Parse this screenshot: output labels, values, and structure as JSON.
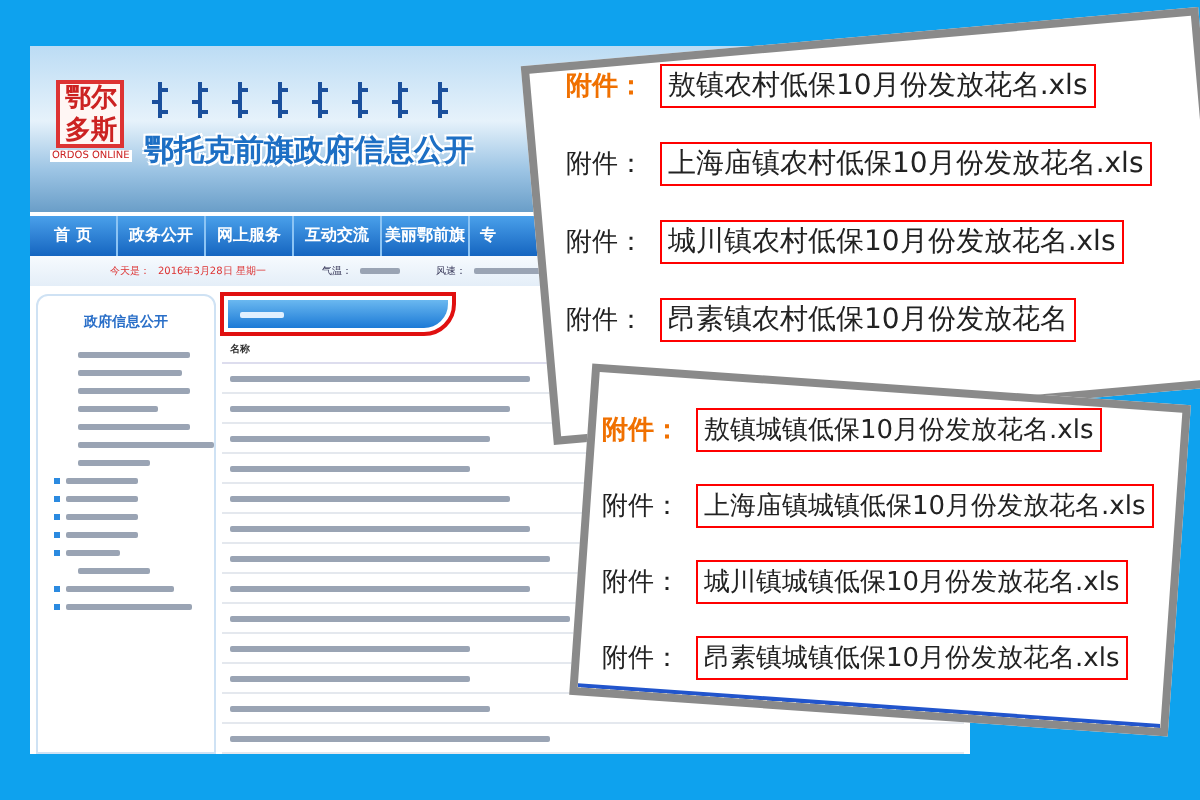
{
  "site": {
    "logo": {
      "seal": "鄂尔多斯",
      "caption": "ORDOS ONLINE"
    },
    "title": "鄂托克前旗政府信息公开"
  },
  "nav": [
    {
      "label": "首 页"
    },
    {
      "label": "政务公开"
    },
    {
      "label": "网上服务"
    },
    {
      "label": "互动交流"
    },
    {
      "label": "美丽鄂前旗"
    },
    {
      "label": "专"
    }
  ],
  "info_bar": {
    "date_label": "今天是：",
    "date": "2016年3月28日 星期一",
    "temp_label": "气温：",
    "wind_label": "风速："
  },
  "sidebar": {
    "title": "政府信息公开"
  },
  "content": {
    "column": "名称"
  },
  "attachments_top": {
    "rows": [
      {
        "label": "附件：",
        "file": "敖镇农村低保10月份发放花名.xls",
        "highlighted": true
      },
      {
        "label": "附件：",
        "file": "上海庙镇农村低保10月份发放花名.xls",
        "highlighted": false
      },
      {
        "label": "附件：",
        "file": "城川镇农村低保10月份发放花名.xls",
        "highlighted": false
      },
      {
        "label": "附件：",
        "file": "昂素镇农村低保10月份发放花名",
        "highlighted": false
      }
    ]
  },
  "attachments_bottom": {
    "rows": [
      {
        "label": "附件：",
        "file": "敖镇城镇低保10月份发放花名.xls",
        "highlighted": true
      },
      {
        "label": "附件：",
        "file": "上海庙镇城镇低保10月份发放花名.xls",
        "highlighted": false
      },
      {
        "label": "附件：",
        "file": "城川镇城镇低保10月份发放花名.xls",
        "highlighted": false
      },
      {
        "label": "附件：",
        "file": "昂素镇城镇低保10月份发放花名.xls",
        "highlighted": false
      }
    ]
  }
}
